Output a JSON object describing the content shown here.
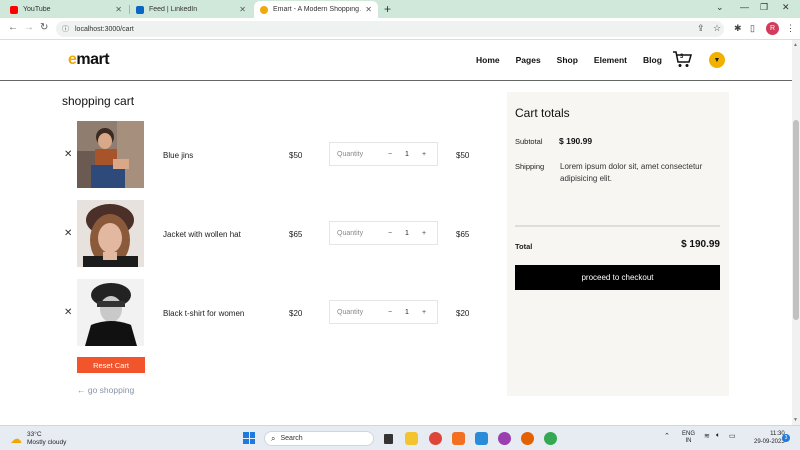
{
  "browser": {
    "tabs": [
      {
        "title": "YouTube",
        "favicon_color": "#ff0000"
      },
      {
        "title": "Feed | LinkedIn",
        "favicon_color": "#0a66c2"
      },
      {
        "title": "Emart - A Modern Shopping Ap...",
        "favicon_color": "#f0a80a"
      }
    ],
    "url": "localhost:3000/cart"
  },
  "header": {
    "logo_e": "e",
    "logo_rest": "mart",
    "nav": [
      "Home",
      "Pages",
      "Shop",
      "Element",
      "Blog"
    ],
    "cart_count": "3"
  },
  "cart": {
    "title": "shopping cart",
    "quantity_label": "Quantity",
    "items": [
      {
        "name": "Blue jins",
        "price": "$50",
        "qty": "1",
        "total": "$50"
      },
      {
        "name": "Jacket with wollen hat",
        "price": "$65",
        "qty": "1",
        "total": "$65"
      },
      {
        "name": "Black t-shirt for women",
        "price": "$20",
        "qty": "1",
        "total": "$20"
      }
    ],
    "reset_label": "Reset Cart",
    "go_shopping": "← go shopping"
  },
  "totals": {
    "heading": "Cart totals",
    "subtotal_label": "Subtotal",
    "subtotal_value": "$ 190.99",
    "shipping_label": "Shipping",
    "shipping_text": "Lorem ipsum dolor sit, amet consectetur adipisicing elit.",
    "total_label": "Total",
    "total_value": "$ 190.99",
    "checkout_label": "proceed to checkout"
  },
  "taskbar": {
    "temp": "33°C",
    "weather": "Mostly cloudy",
    "search": "Search",
    "lang1": "ENG",
    "lang2": "IN",
    "time": "11:30",
    "date": "29-09-2023",
    "notif_count": "3"
  }
}
